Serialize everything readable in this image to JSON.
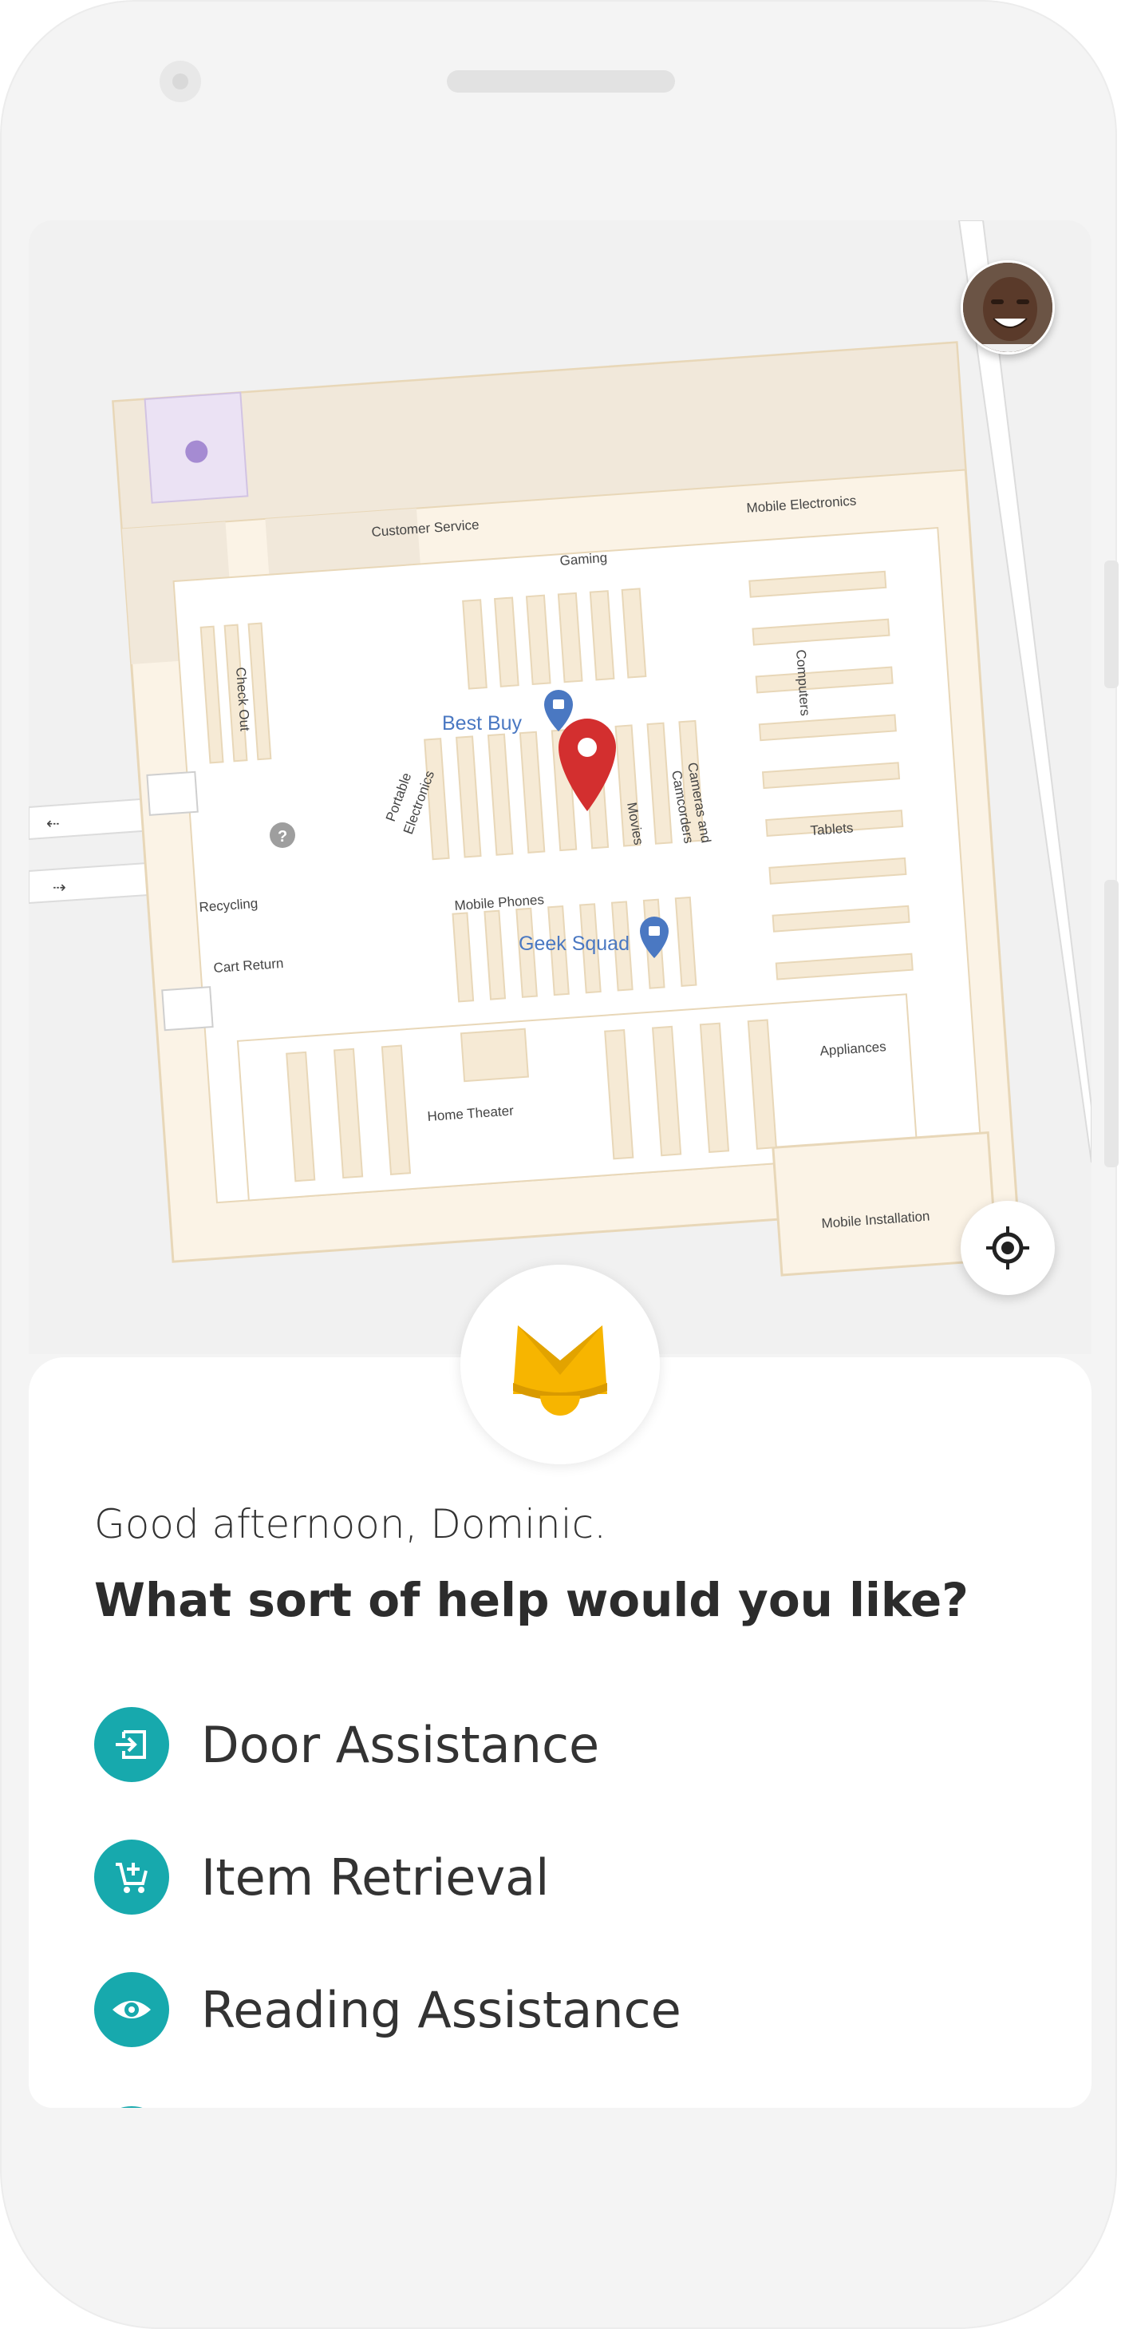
{
  "user": {
    "avatar_icon": "user-avatar"
  },
  "map": {
    "labels": {
      "customer_service": "Customer Service",
      "gaming": "Gaming",
      "mobile_electronics": "Mobile Electronics",
      "check_out": "Check Out",
      "computers": "Computers",
      "portable": "Portable",
      "electronics": "Electronics",
      "movies": "Movies",
      "cameras_and": "Cameras and",
      "camcorders": "Camcorders",
      "tablets": "Tablets",
      "recycling": "Recycling",
      "mobile_phones": "Mobile Phones",
      "cart_return": "Cart Return",
      "appliances": "Appliances",
      "home_theater": "Home Theater",
      "mobile_installation": "Mobile Installation"
    },
    "pois": {
      "best_buy": "Best Buy",
      "geek_squad": "Geek Squad"
    },
    "colors": {
      "shelf": "#f6ead5",
      "shelf_stroke": "#e8d7b8",
      "floor": "#ffffff",
      "pin": "#d32f2f",
      "poi_blue": "#4a78c2"
    }
  },
  "sheet": {
    "greeting": "Good afternoon, Dominic.",
    "question": "What sort of help would you like?",
    "options": [
      {
        "label": "Door Assistance",
        "icon": "door-enter-icon"
      },
      {
        "label": "Item Retrieval",
        "icon": "cart-add-icon"
      },
      {
        "label": "Reading Assistance",
        "icon": "eye-icon"
      }
    ],
    "accent_color": "#17a9ad",
    "brand_colors": {
      "primary": "#f7b500",
      "secondary": "#d99a00"
    }
  }
}
